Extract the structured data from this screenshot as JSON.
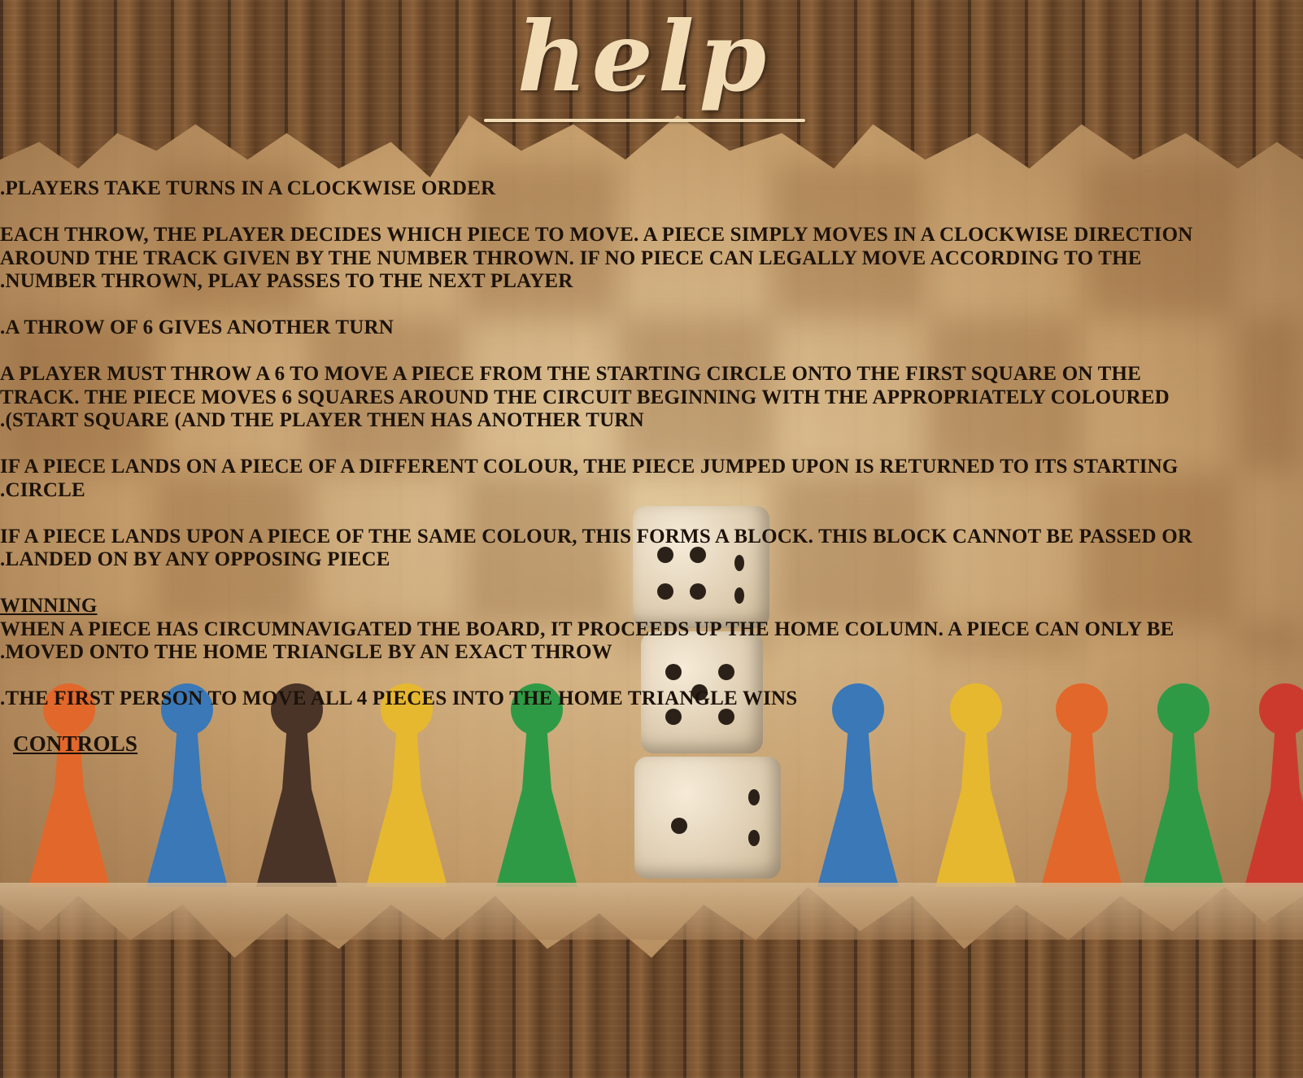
{
  "title": "help",
  "rules": [
    ".PLAYERS TAKE TURNS IN A CLOCKWISE ORDER",
    "EACH THROW, THE PLAYER DECIDES WHICH PIECE TO MOVE. A PIECE SIMPLY MOVES IN A CLOCKWISE DIRECTION\nAROUND THE TRACK GIVEN BY THE NUMBER THROWN. IF NO PIECE CAN LEGALLY MOVE ACCORDING TO THE\n.NUMBER THROWN, PLAY PASSES TO THE NEXT PLAYER",
    ".A THROW OF 6 GIVES ANOTHER TURN",
    "A PLAYER MUST THROW A 6 TO MOVE A PIECE FROM THE STARTING CIRCLE ONTO THE FIRST SQUARE ON THE\nTRACK. THE PIECE MOVES 6 SQUARES AROUND THE CIRCUIT BEGINNING WITH THE APPROPRIATELY COLOURED\n.(START SQUARE (AND THE PLAYER THEN HAS ANOTHER TURN",
    "IF A PIECE LANDS ON A PIECE OF A DIFFERENT COLOUR, THE PIECE JUMPED UPON IS RETURNED TO ITS STARTING\n.CIRCLE",
    "IF A PIECE LANDS UPON A PIECE OF THE SAME COLOUR, THIS FORMS A BLOCK. THIS BLOCK CANNOT BE PASSED OR\n.LANDED ON BY ANY OPPOSING PIECE"
  ],
  "winning": {
    "heading": "WINNING",
    "text": "WHEN A PIECE HAS CIRCUMNAVIGATED THE BOARD, IT PROCEEDS UP THE HOME COLUMN. A PIECE CAN ONLY BE\n.MOVED ONTO THE HOME TRIANGLE BY AN EXACT THROW",
    "final": ".THE FIRST PERSON TO MOVE ALL 4 PIECES INTO THE HOME TRIANGLE WINS"
  },
  "controls_label": "CONTROLS",
  "colors": {
    "text": "#1c1209",
    "title": "#f2dcb5",
    "pawn_orange": "#e2672a",
    "pawn_blue": "#3a78b8",
    "pawn_brown": "#4a3428",
    "pawn_yellow": "#e6b830",
    "pawn_green": "#2f9a46",
    "pawn_red": "#cc3a2e"
  }
}
